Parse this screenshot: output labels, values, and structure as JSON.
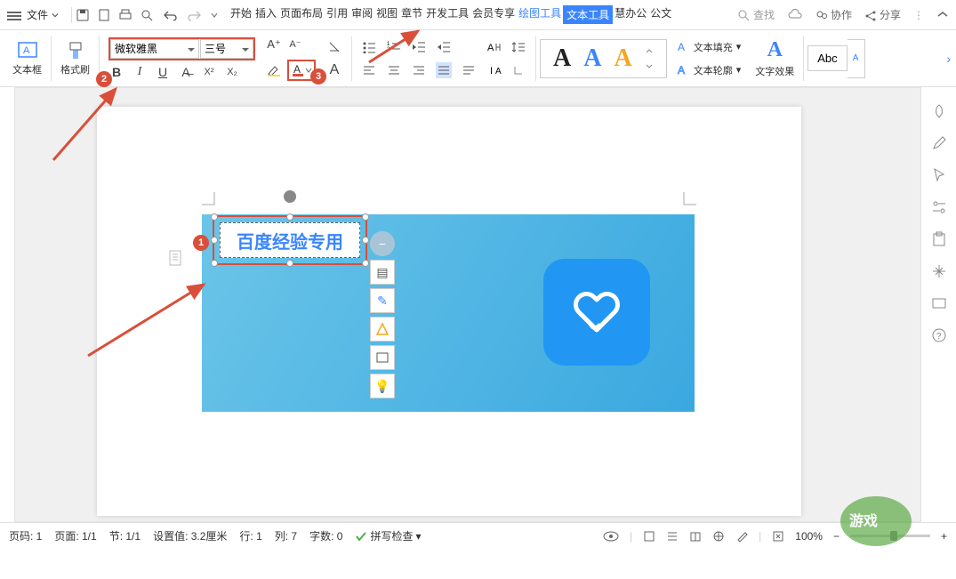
{
  "topbar": {
    "file_label": "文件",
    "tabs": [
      "开始",
      "插入",
      "页面布局",
      "引用",
      "审阅",
      "视图",
      "章节",
      "开发工具",
      "会员专享",
      "绘图工具",
      "文本工具",
      "慧办公",
      "公文"
    ],
    "draw_tab_index": 9,
    "active_tab_index": 10,
    "search_placeholder": "查找",
    "collab": "协作",
    "share": "分享"
  },
  "ribbon": {
    "textbox": "文本框",
    "format_painter": "格式刷",
    "font_name": "微软雅黑",
    "font_size": "三号",
    "fill_label": "文本填充",
    "outline_label": "文本轮廓",
    "effect_label": "文字效果",
    "abc": "Abc",
    "wordart_a": "A"
  },
  "canvas": {
    "textbox_text": "百度经验专用"
  },
  "annotations": {
    "b1": "1",
    "b2": "2",
    "b3": "3"
  },
  "float_icons": [
    "−",
    "▤",
    "✎",
    "◇",
    "▭",
    "💡"
  ],
  "statusbar": {
    "page_no": "页码: 1",
    "page": "页面: 1/1",
    "section": "节: 1/1",
    "pos": "设置值: 3.2厘米",
    "row": "行: 1",
    "col": "列: 7",
    "words": "字数: 0",
    "spell": "拼写检查",
    "zoom": "100%"
  }
}
